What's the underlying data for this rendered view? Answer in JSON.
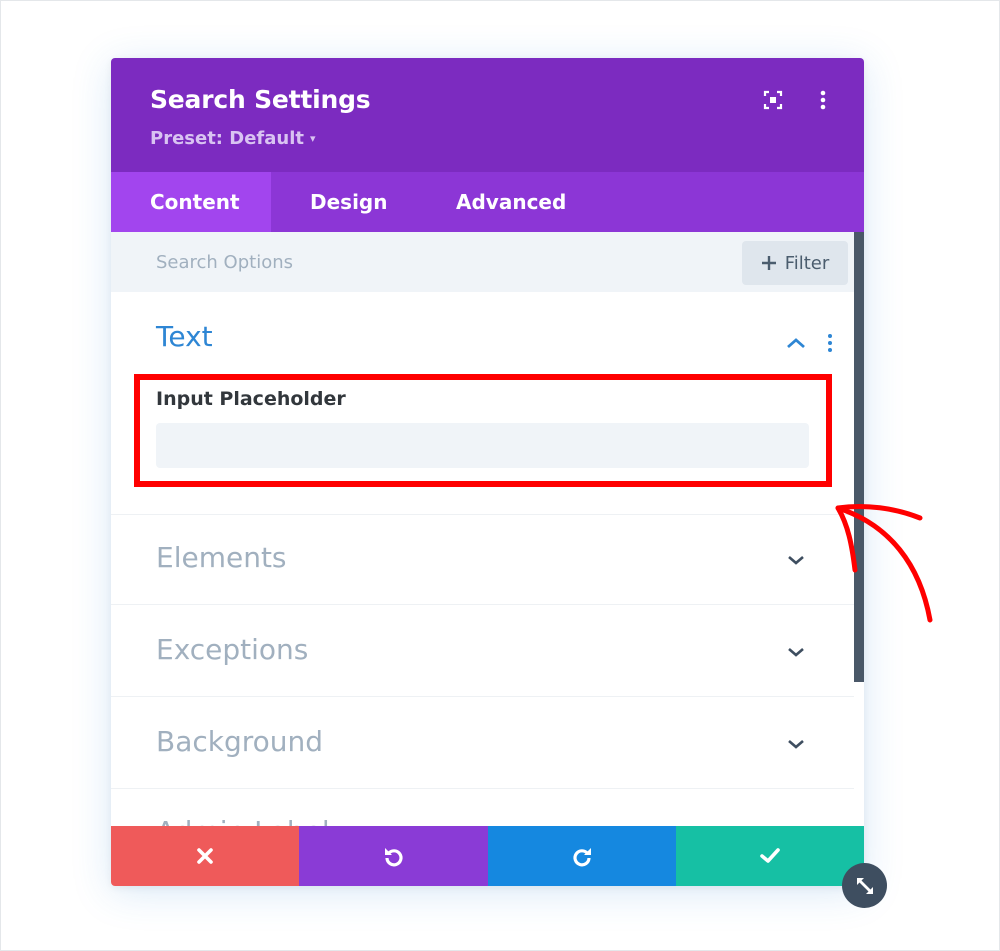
{
  "header": {
    "title": "Search Settings",
    "preset": "Preset: Default",
    "caret": "▾"
  },
  "tabs": [
    {
      "label": "Content"
    },
    {
      "label": "Design"
    },
    {
      "label": "Advanced"
    }
  ],
  "toolbar": {
    "search_placeholder": "Search Options",
    "filter_label": "Filter",
    "filter_icon": "+"
  },
  "sections": [
    {
      "title": "Text",
      "expanded": true
    },
    {
      "title": "Elements",
      "expanded": false
    },
    {
      "title": "Exceptions",
      "expanded": false
    },
    {
      "title": "Background",
      "expanded": false
    },
    {
      "title": "Admin Label",
      "expanded": false
    }
  ],
  "text_section": {
    "field_label": "Input Placeholder",
    "field_value": ""
  },
  "icons": {
    "expand": "expand-icon",
    "more": "more-vertical-icon",
    "cancel": "close-icon",
    "undo": "undo-icon",
    "redo": "redo-icon",
    "save": "check-icon",
    "resize": "resize-diagonal-icon"
  },
  "colors": {
    "header": "#7c2bc0",
    "tabs": "#8c36d6",
    "tab_active": "#a245ee",
    "section_open": "#2e86d4",
    "cancel": "#ef5a5a",
    "undo": "#8a3bd6",
    "redo": "#1588e0",
    "save": "#16c0a4",
    "annotation": "#ff0000"
  }
}
